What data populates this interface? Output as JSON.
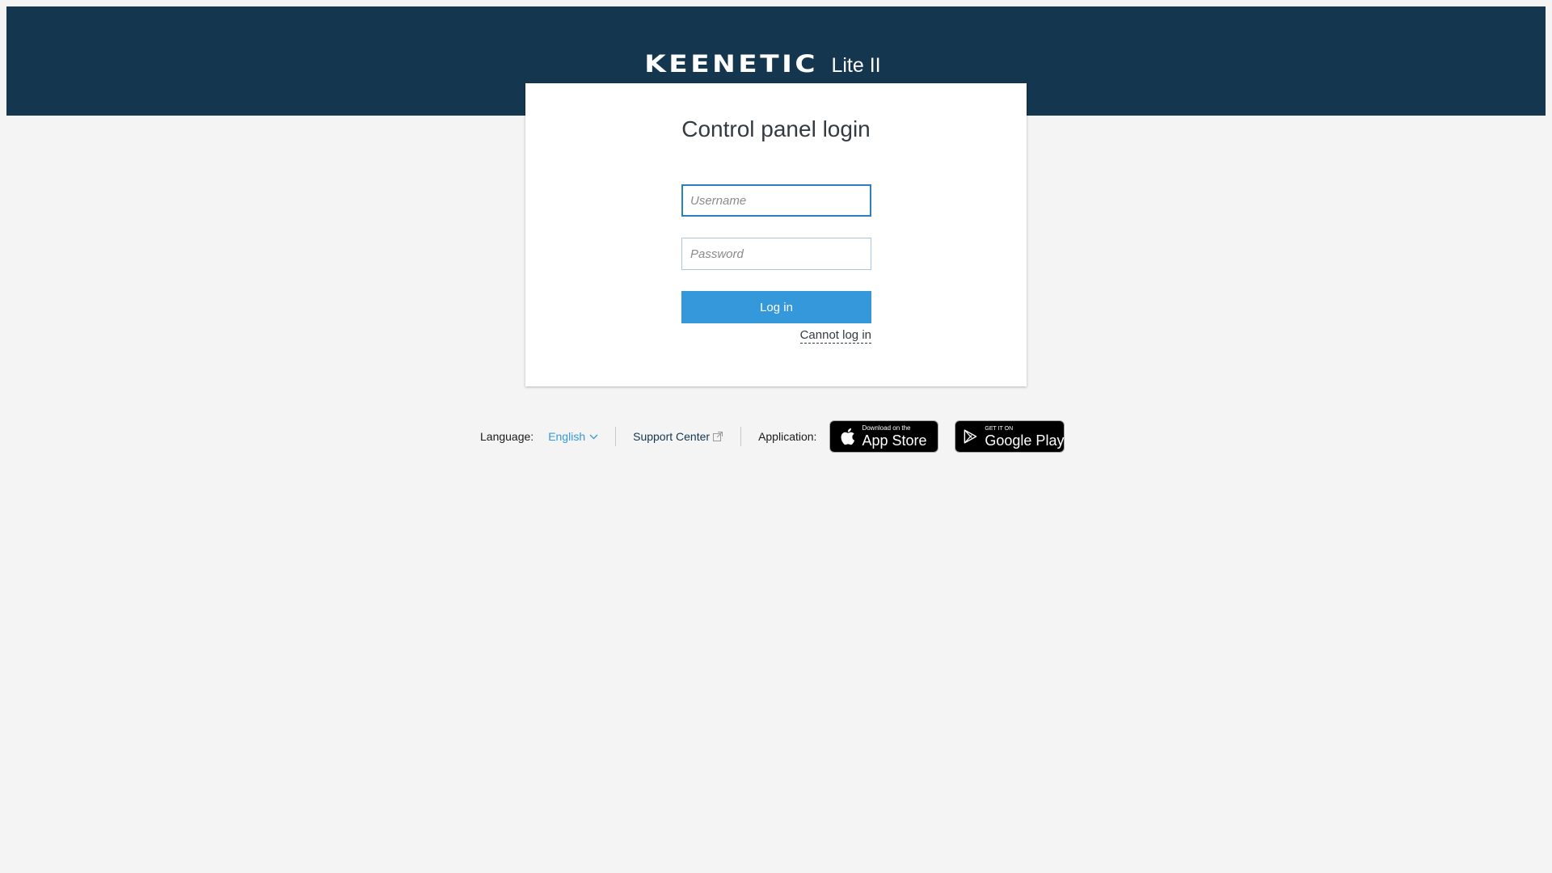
{
  "header": {
    "brand": "KEENETIC",
    "model": "Lite II",
    "background_color": "#14364f"
  },
  "login": {
    "title": "Control panel login",
    "username_placeholder": "Username",
    "password_placeholder": "Password",
    "login_button": "Log in",
    "cannot_login": "Cannot log in",
    "button_color": "#3498db"
  },
  "footer": {
    "language_label": "Language:",
    "language_value": "English",
    "support_center": "Support Center",
    "application_label": "Application:",
    "app_store": {
      "small": "Download on the",
      "big": "App Store"
    },
    "google_play": {
      "small": "GET IT ON",
      "big": "Google Play"
    }
  }
}
